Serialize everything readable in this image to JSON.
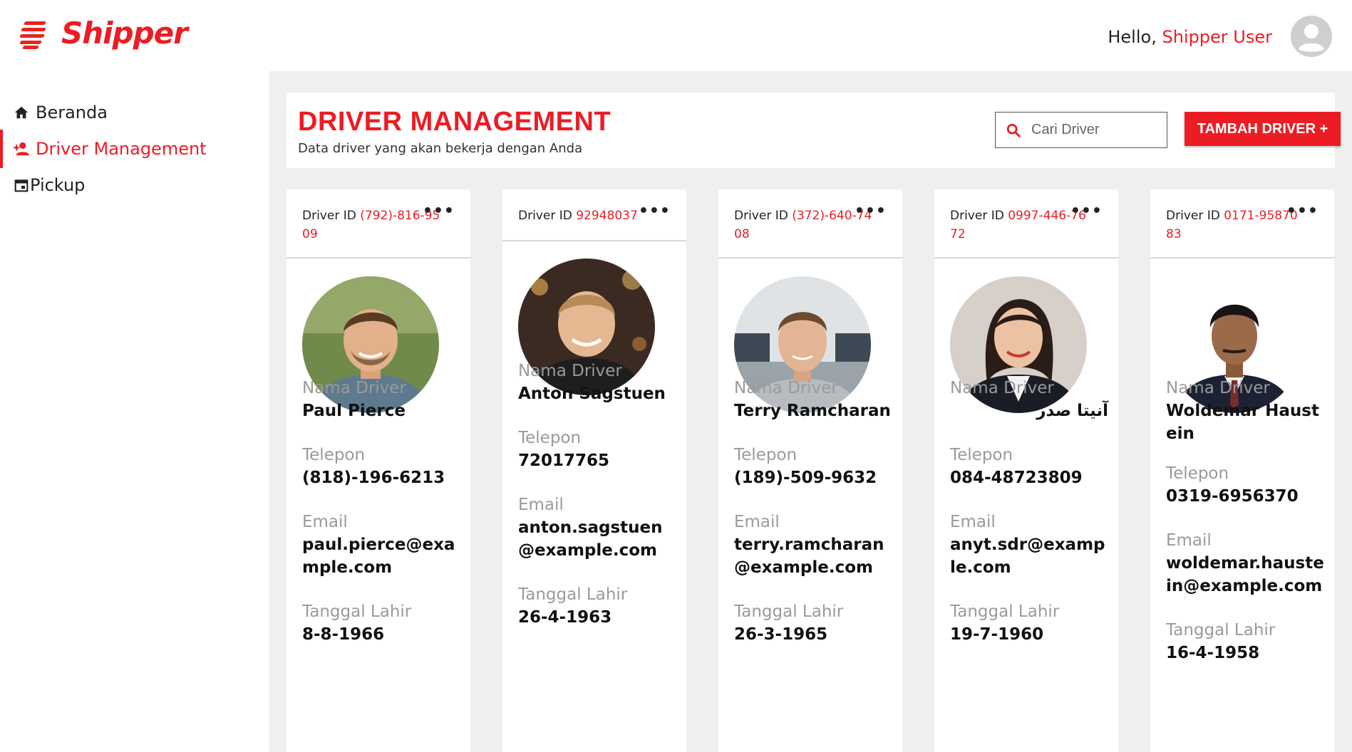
{
  "brand": {
    "name": "Shipper",
    "accent_color": "#ec1c24"
  },
  "header": {
    "greeting_prefix": "Hello, ",
    "user_name": "Shipper User",
    "avatar_icon": "user-avatar-icon"
  },
  "sidebar": {
    "items": [
      {
        "label": "Beranda",
        "icon": "home-icon",
        "active": false
      },
      {
        "label": "Driver Management",
        "icon": "person-add-icon",
        "active": true
      },
      {
        "label": "Pickup",
        "icon": "calendar-icon",
        "active": false
      }
    ]
  },
  "page": {
    "title": "DRIVER MANAGEMENT",
    "subtitle": "Data driver yang akan bekerja dengan Anda",
    "search_placeholder": "Cari Driver",
    "add_button_label": "TAMBAH DRIVER +"
  },
  "labels": {
    "driver_id": "Driver ID ",
    "name": "Nama Driver",
    "phone": "Telepon",
    "email": "Email",
    "birthdate": "Tanggal Lahir",
    "more": "•••"
  },
  "drivers": [
    {
      "id_line1": "(792)-816-95",
      "id_line2": "09",
      "name": "Paul Pierce",
      "phone": "(818)-196-6213",
      "email": "paul.pierce@example.com",
      "birthdate": "8-8-1966"
    },
    {
      "id_line1": "92948037",
      "id_line2": "",
      "name": "Anton Sagstuen",
      "phone": "72017765",
      "email": "anton.sagstuen@example.com",
      "birthdate": "26-4-1963"
    },
    {
      "id_line1": "(372)-640-74",
      "id_line2": "08",
      "name": "Terry Ramcharan",
      "phone": "(189)-509-9632",
      "email": "terry.ramcharan@example.com",
      "birthdate": "26-3-1965"
    },
    {
      "id_line1": "0997-446-76",
      "id_line2": "72",
      "name": "آنیتا صدر",
      "phone": "084-48723809",
      "email": "anyt.sdr@example.com",
      "birthdate": "19-7-1960"
    },
    {
      "id_line1": "0171-95870",
      "id_line2": "83",
      "name": "Woldemar Haustein",
      "phone": "0319-6956370",
      "email": "woldemar.haustein@example.com",
      "birthdate": "16-4-1958"
    }
  ]
}
